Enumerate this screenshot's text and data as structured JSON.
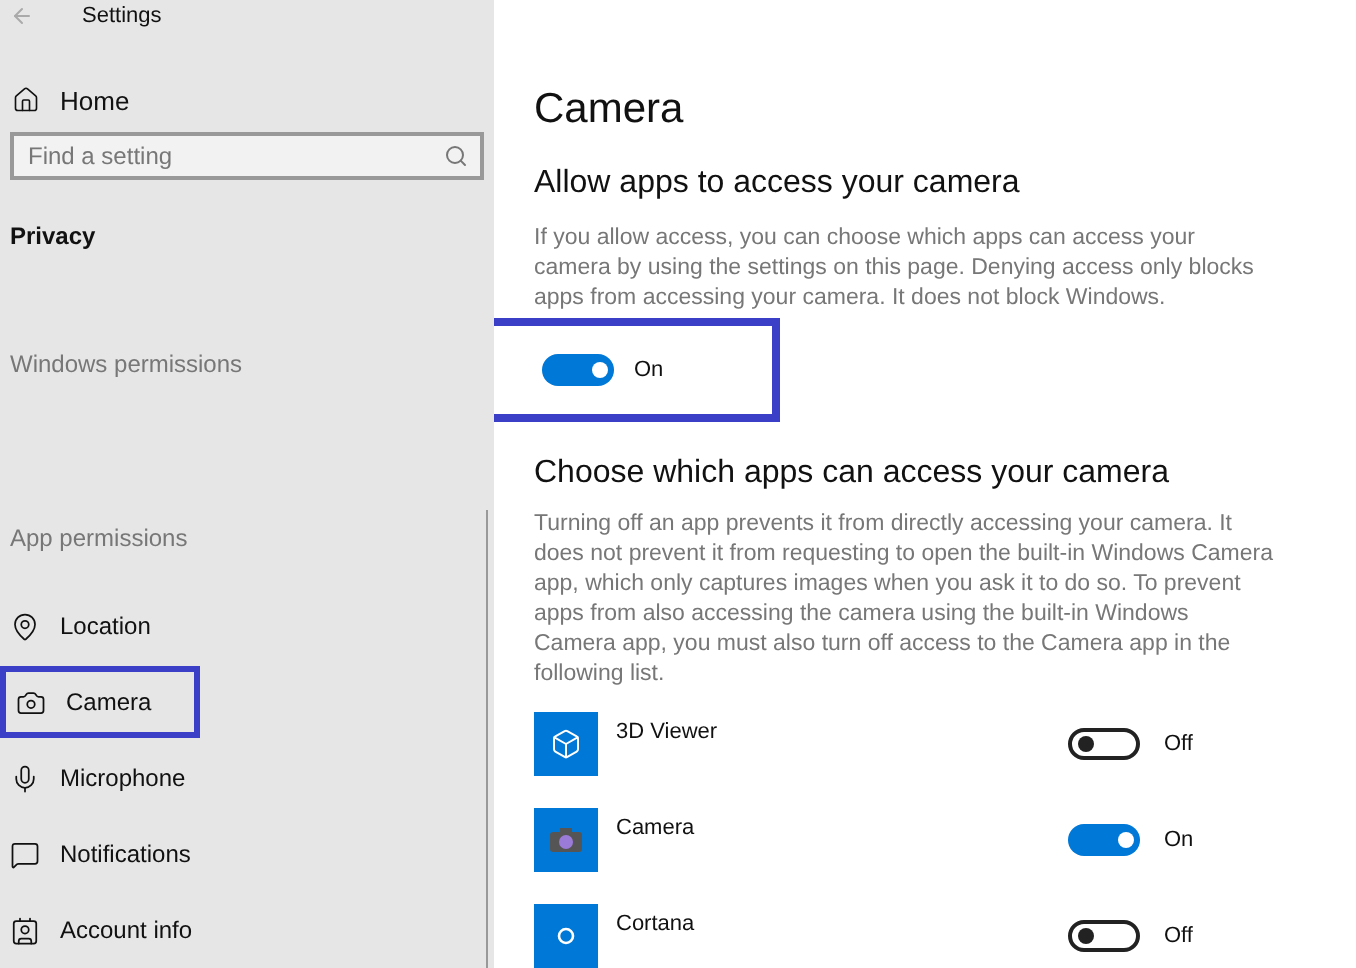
{
  "window": {
    "title": "Settings"
  },
  "sidebar": {
    "home": "Home",
    "search": {
      "placeholder": "Find a setting"
    },
    "section": "Privacy",
    "groups": [
      {
        "heading": "Windows permissions"
      },
      {
        "heading": "App permissions",
        "items": [
          {
            "label": "Location",
            "kind": "location",
            "highlighted": false
          },
          {
            "label": "Camera",
            "kind": "camera",
            "highlighted": true
          },
          {
            "label": "Microphone",
            "kind": "microphone",
            "highlighted": false
          },
          {
            "label": "Notifications",
            "kind": "notifications",
            "highlighted": false
          },
          {
            "label": "Account info",
            "kind": "account",
            "highlighted": false
          }
        ]
      }
    ]
  },
  "main": {
    "title": "Camera",
    "allow": {
      "heading": "Allow apps to access your camera",
      "description": "If you allow access, you can choose which apps can access your camera by using the settings on this page. Denying access only blocks apps from accessing your camera. It does not block Windows.",
      "toggle": {
        "on": true,
        "label": "On",
        "highlighted": true
      }
    },
    "apps": {
      "heading": "Choose which apps can access your camera",
      "description": "Turning off an app prevents it from directly accessing your camera. It does not prevent it from requesting to open the built-in Windows Camera app, which only captures images when you ask it to do so. To prevent apps from also accessing the camera using the built-in Windows Camera app, you must also turn off access to the Camera app in the following list.",
      "items": [
        {
          "name": "3D Viewer",
          "kind": "cube",
          "on": false,
          "label": "Off"
        },
        {
          "name": "Camera",
          "kind": "camera",
          "on": true,
          "label": "On"
        },
        {
          "name": "Cortana",
          "kind": "circle",
          "on": false,
          "label": "Off"
        }
      ]
    }
  }
}
